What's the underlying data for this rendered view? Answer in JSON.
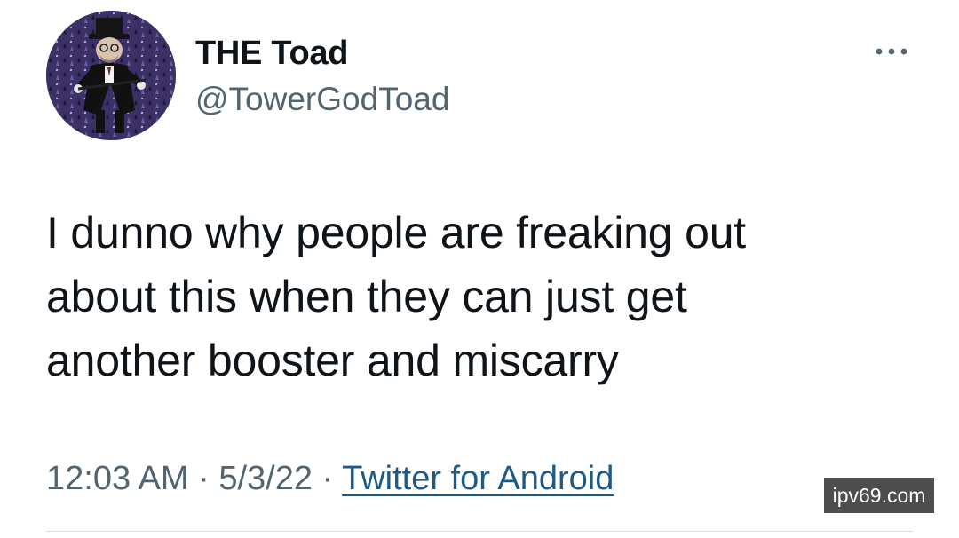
{
  "author": {
    "display_name": "THE Toad",
    "handle": "@TowerGodToad",
    "avatar_icon": "toad-avatar-icon"
  },
  "menu": {
    "icon": "more-options-icon"
  },
  "tweet": {
    "lines": [
      "I dunno why people are freaking out",
      "about this when they can just get",
      "another booster and miscarry"
    ]
  },
  "meta": {
    "time": "12:03 AM",
    "separator": " · ",
    "date": "5/3/22",
    "source": "Twitter for Android"
  },
  "watermark": {
    "text": "ipv69.com"
  },
  "colors": {
    "text": "#0f1419",
    "secondary": "#536471",
    "link": "#1d5a86",
    "avatar_bg": "#3a2f63"
  }
}
